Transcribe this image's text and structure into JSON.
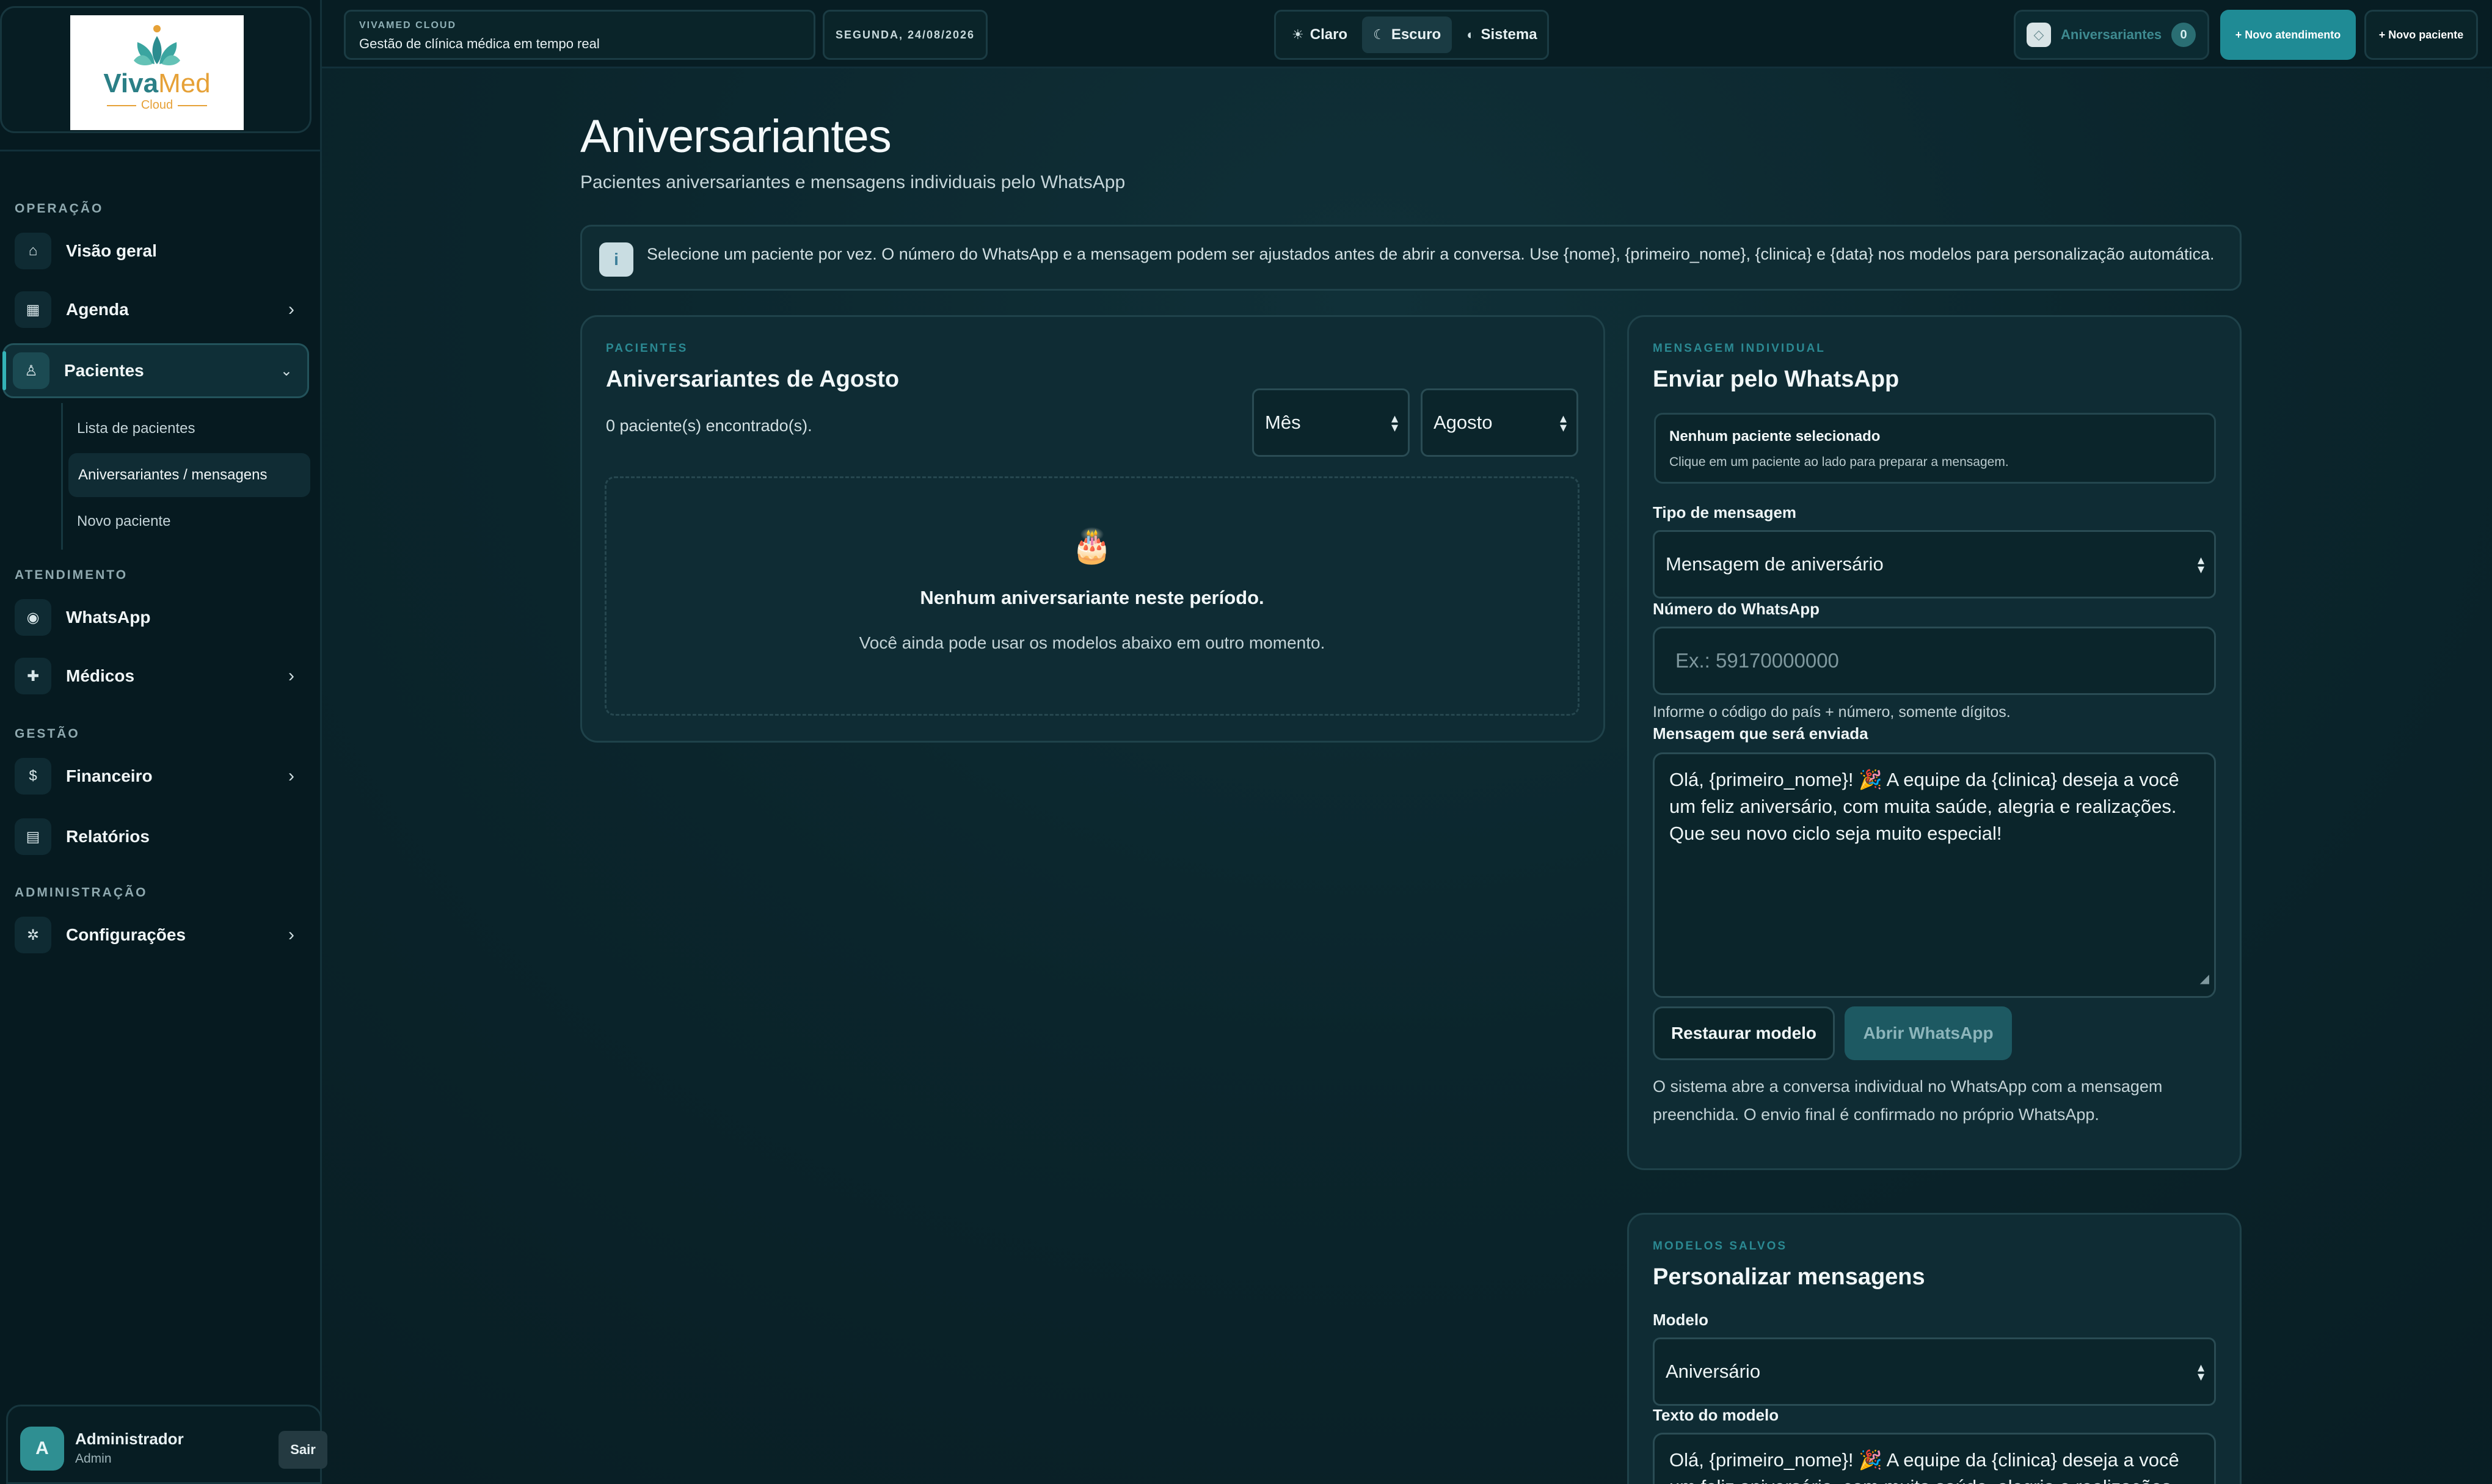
{
  "brand": {
    "logo_name_1": "Viva",
    "logo_name_2": "Med",
    "logo_sub": "Cloud",
    "kicker": "VIVAMED CLOUD",
    "description": "Gestão de clínica médica em tempo real"
  },
  "topbar": {
    "date": "SEGUNDA, 24/08/2026",
    "theme_options": [
      {
        "label": "Claro",
        "icon": "sun-icon"
      },
      {
        "label": "Escuro",
        "icon": "moon-icon"
      },
      {
        "label": "Sistema",
        "icon": "half-circle-icon"
      }
    ],
    "active_theme": "Escuro",
    "birthdays_label": "Aniversariantes",
    "birthdays_count": "0",
    "new_appointment": "+ Novo atendimento",
    "new_patient": "+ Novo paciente"
  },
  "sidebar": {
    "sections": {
      "operacao": "OPERAÇÃO",
      "atendimento": "ATENDIMENTO",
      "gestao": "GESTÃO",
      "administracao": "ADMINISTRAÇÃO"
    },
    "items": {
      "visao_geral": "Visão geral",
      "agenda": "Agenda",
      "pacientes": "Pacientes",
      "whatsapp": "WhatsApp",
      "medicos": "Médicos",
      "financeiro": "Financeiro",
      "relatorios": "Relatórios",
      "configuracoes": "Configurações"
    },
    "icons": {
      "visao_geral": "⌂",
      "agenda": "▦",
      "pacientes": "♙",
      "whatsapp": "◉",
      "medicos": "✚",
      "financeiro": "$",
      "relatorios": "▤",
      "configuracoes": "✲"
    },
    "sub_items": {
      "lista": "Lista de pacientes",
      "aniversariantes": "Aniversariantes / mensagens",
      "novo": "Novo paciente"
    },
    "user": {
      "initial": "A",
      "name": "Administrador",
      "role": "Admin",
      "logout": "Sair"
    }
  },
  "page": {
    "title": "Aniversariantes",
    "subtitle": "Pacientes aniversariantes e mensagens individuais pelo WhatsApp",
    "info": "Selecione um paciente por vez. O número do WhatsApp e a mensagem podem ser ajustados antes de abrir a conversa. Use {nome}, {primeiro_nome}, {clinica} e {data} nos modelos para personalização automática."
  },
  "patients_card": {
    "kicker": "PACIENTES",
    "title": "Aniversariantes de Agosto",
    "count_text": "0 paciente(s) encontrado(s).",
    "period_select": "Mês",
    "month_select": "Agosto",
    "empty_icon": "🎂",
    "empty_title": "Nenhum aniversariante neste período.",
    "empty_sub": "Você ainda pode usar os modelos abaixo em outro momento."
  },
  "message_card": {
    "kicker": "MENSAGEM INDIVIDUAL",
    "title": "Enviar pelo WhatsApp",
    "no_patient_title": "Nenhum paciente selecionado",
    "no_patient_sub": "Clique em um paciente ao lado para preparar a mensagem.",
    "type_label": "Tipo de mensagem",
    "type_value": "Mensagem de aniversário",
    "number_label": "Número do WhatsApp",
    "number_placeholder": "Ex.: 59170000000",
    "number_hint": "Informe o código do país + número, somente dígitos.",
    "message_label": "Mensagem que será enviada",
    "message_lines": [
      "Olá, {primeiro_nome}! 🎉 A equipe da {clinica} deseja a você",
      "um feliz aniversário, com muita saúde, alegria e realizações.",
      "Que seu novo ciclo seja muito especial!"
    ],
    "restore_button": "Restaurar modelo",
    "open_button": "Abrir WhatsApp",
    "note_lines": [
      "O sistema abre a conversa individual no WhatsApp com a mensagem",
      "preenchida. O envio final é confirmado no próprio WhatsApp."
    ]
  },
  "templates_card": {
    "kicker": "MODELOS SALVOS",
    "title": "Personalizar mensagens",
    "model_label": "Modelo",
    "model_value": "Aniversário",
    "text_label": "Texto do modelo",
    "text_lines": [
      "Olá, {primeiro_nome}! 🎉 A equipe da {clinica} deseja a você",
      "um feliz aniversário, com muita saúde, alegria e realizações."
    ]
  }
}
